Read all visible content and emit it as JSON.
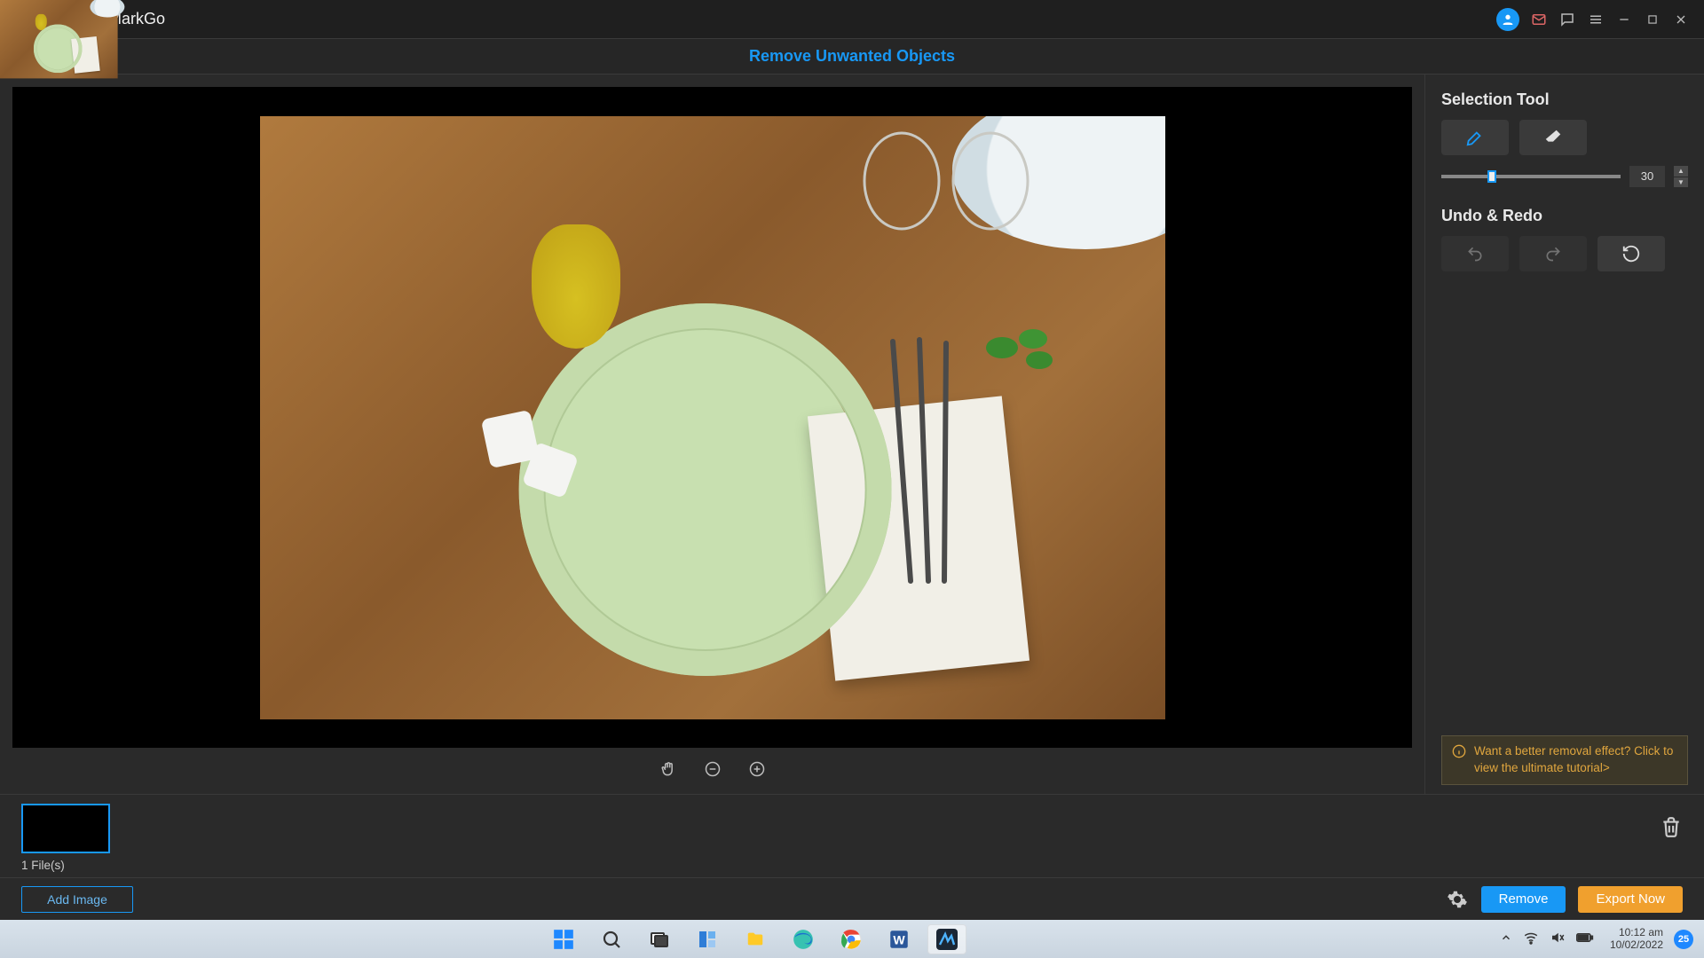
{
  "app": {
    "title": "iMyFone MarkGo"
  },
  "header": {
    "mode": "Remove Unwanted Objects"
  },
  "sidepanel": {
    "selection_label": "Selection Tool",
    "brush_size": "30",
    "undo_label": "Undo & Redo"
  },
  "tutorial": {
    "text": "Want a better removal effect? Click to view the ultimate tutorial>"
  },
  "files": {
    "count_label": "1 File(s)",
    "add_label": "Add Image"
  },
  "actions": {
    "remove": "Remove",
    "export": "Export Now"
  },
  "system_tray": {
    "time": "10:12 am",
    "date": "10/02/2022",
    "temp_badge": "25"
  }
}
